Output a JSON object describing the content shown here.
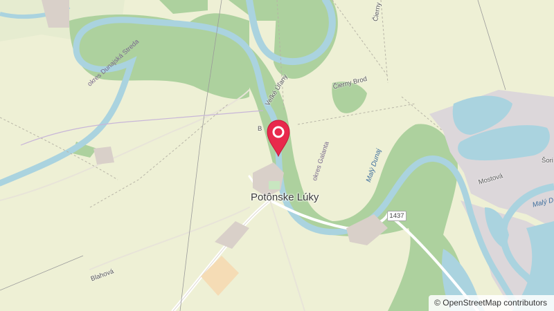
{
  "map": {
    "place_label": "Potônske Lúky",
    "road_shield": "1437",
    "attribution": "© OpenStreetMap contributors",
    "labels": {
      "district_dunajska": "okres Dunajská Streda",
      "district_galanta": "okres Galanta",
      "velke_ulany": "Veľké Úľany",
      "cierny_brod": "Čierny Brod",
      "cierny_top": "Čierny",
      "maly_dunaj": "Malý Dunaj",
      "maly_right": "Malý D",
      "mostova": "Mostová",
      "blahova": "Blahová",
      "sori": "Šori",
      "b_fragment": "B"
    },
    "colors": {
      "land": "#f2efe4",
      "farmland": "#eef0d5",
      "forest": "#add19e",
      "water": "#aad3df",
      "industrial": "#dcd7da",
      "marker": "#e8294c"
    },
    "marker_icon": "map-pin-icon"
  }
}
